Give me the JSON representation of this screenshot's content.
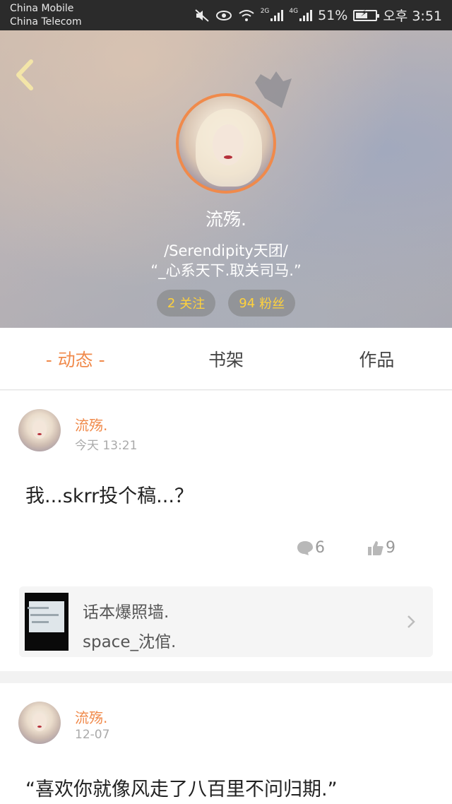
{
  "status_bar": {
    "carrier1": "China Mobile",
    "carrier2": "China Telecom",
    "sig1_label": "2G",
    "sig2_label": "4G",
    "battery": "51%",
    "time": "오후 3:51"
  },
  "profile": {
    "name": "流殇.",
    "signature_line1": "/Serendipity天团/",
    "signature_line2": "“_心系天下.取关司马.”",
    "following_count": "2",
    "following_label": "关注",
    "followers_count": "94",
    "followers_label": "粉丝"
  },
  "tabs": [
    {
      "label": "- 动态 -",
      "active": true
    },
    {
      "label": "书架",
      "active": false
    },
    {
      "label": "作品",
      "active": false
    }
  ],
  "posts": [
    {
      "author": "流殇.",
      "time": "今天 13:21",
      "text": "我...skrr投个稿...？",
      "comments": "6",
      "likes": "9",
      "shared": {
        "title": "话本爆照墙.",
        "subtitle": "space_沈倌."
      }
    },
    {
      "author": "流殇.",
      "time": "12-07",
      "text": "“喜欢你就像风走了八百里不问归期.”"
    }
  ],
  "colors": {
    "accent": "#f08a4b",
    "stat_text": "#ffd23c",
    "statusbar_bg": "#2b2b2b"
  }
}
